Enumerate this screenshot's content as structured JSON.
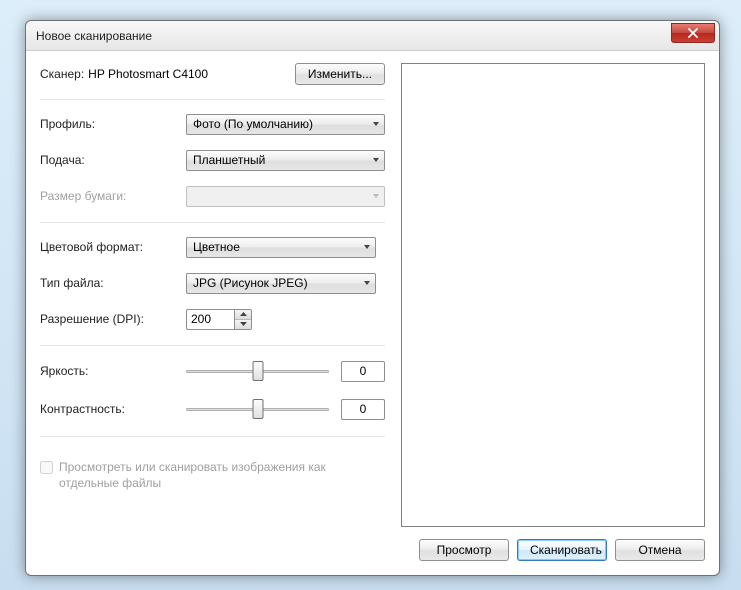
{
  "window": {
    "title": "Новое сканирование"
  },
  "scanner": {
    "label": "Сканер:",
    "name": "HP Photosmart C4100",
    "change_button": "Изменить..."
  },
  "fields": {
    "profile_label": "Профиль:",
    "profile_value": "Фото (По умолчанию)",
    "source_label": "Подача:",
    "source_value": "Планшетный",
    "paper_label": "Размер бумаги:",
    "paper_value": "",
    "color_label": "Цветовой формат:",
    "color_value": "Цветное",
    "filetype_label": "Тип файла:",
    "filetype_value": "JPG (Рисунок JPEG)",
    "dpi_label": "Разрешение (DPI):",
    "dpi_value": "200",
    "brightness_label": "Яркость:",
    "brightness_value": "0",
    "contrast_label": "Контрастность:",
    "contrast_value": "0"
  },
  "checkbox": {
    "label": "Просмотреть или сканировать изображения как отдельные файлы"
  },
  "footer": {
    "preview": "Просмотр",
    "scan": "Сканировать",
    "cancel": "Отмена"
  }
}
